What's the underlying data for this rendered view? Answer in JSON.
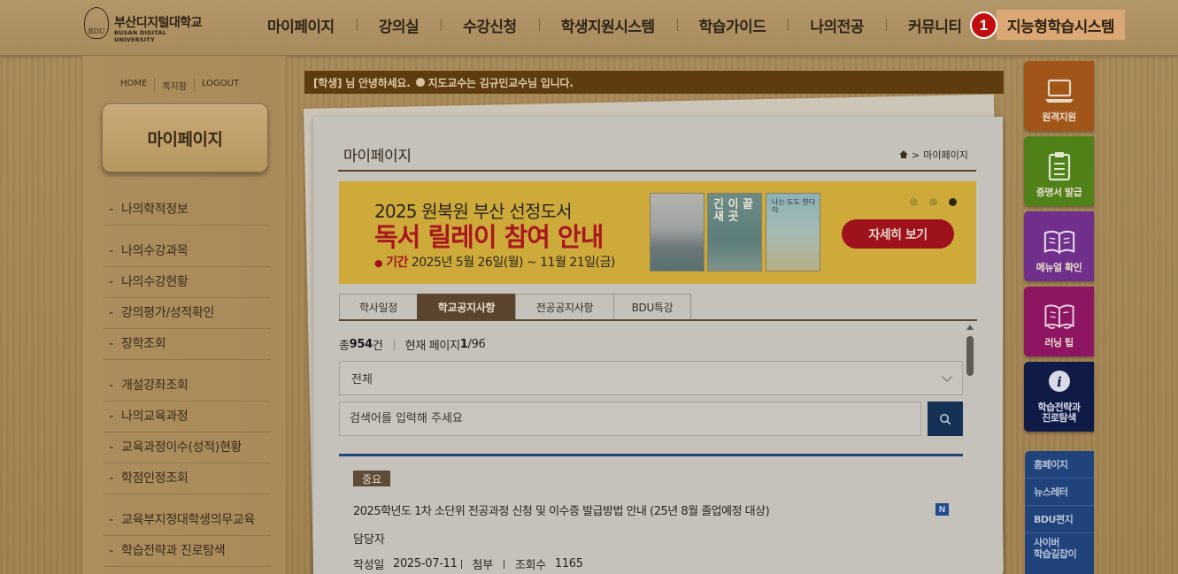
{
  "brand": {
    "name": "부산디지털대학교",
    "sub": "BUSAN DIGITAL UNIVERSITY",
    "mark": "BDU"
  },
  "topnav": {
    "items": [
      "마이페이지",
      "강의실",
      "수강신청",
      "학생지원시스템",
      "학습가이드",
      "나의전공",
      "커뮤니티"
    ],
    "special": "지능형학습시스템",
    "badge": "1"
  },
  "utils": [
    "HOME",
    "쪽지함",
    "LOGOUT"
  ],
  "sidebar": {
    "title": "마이페이지",
    "items": [
      "나의학적정보",
      "나의수강과목",
      "나의수강현황",
      "강의평가/성적확인",
      "장학조회",
      "개설강좌조회",
      "나의교육과정",
      "교육과정이수(성적)현황",
      "학점인정조회",
      "교육부지정대학생의무교육",
      "학습전략과 진로탐색"
    ]
  },
  "greeting": {
    "text1": "[학생] 님 안녕하세요.",
    "text2": "지도교수는 김규민교수님 입니다."
  },
  "page": {
    "title": "마이페이지",
    "breadcrumb_sep": ">",
    "breadcrumb": "마이페이지"
  },
  "banner": {
    "line1": "2025 원북원 부산 선정도서",
    "line2": "독서 릴레이 참여 안내",
    "period_label": "기간",
    "period": "2025년 5월 26일(월) ~ 11월 21일(금)",
    "book2_title": "긴 이 끝 새 곳",
    "book3_title": "나는 도도 한다이",
    "button": "자세히 보기",
    "active_slide": 3
  },
  "tabs": [
    "학사일정",
    "학교공지사항",
    "전공공지사항",
    "BDU특강"
  ],
  "active_tab": 1,
  "listing": {
    "total_prefix": "총 ",
    "total": "954",
    "total_suffix": "건",
    "page_prefix": "현재 페이지 ",
    "page_current": "1",
    "page_total": "/96",
    "filter": "전체",
    "search_placeholder": "검색어를 입력해 주세요"
  },
  "notice": {
    "badge": "중요",
    "title": "2025학년도 1차 소단위 전공과정 신청 및 이수증 발급방법 안내 (25년 8월 졸업예정 대상)",
    "new_badge": "N",
    "author": "담당자",
    "date_label": "작성일",
    "date": "2025-07-11",
    "attach_label": "첨부",
    "views_label": "조회수",
    "views": "1165"
  },
  "quickmenu": {
    "items": [
      {
        "label": "원격지원",
        "icon": "laptop-icon",
        "color": "#a25518"
      },
      {
        "label": "증명서 발급",
        "icon": "document-icon",
        "color": "#4f8118"
      },
      {
        "label": "메뉴얼 확인",
        "icon": "book-icon",
        "color": "#6f2f8a"
      },
      {
        "label": "러닝 팁",
        "icon": "reading-book-icon",
        "color": "#8d1561"
      },
      {
        "label": "학습전략과 진로탐색",
        "icon": "info-icon",
        "color": "#101a47"
      }
    ],
    "q5_line1": "학습전략과",
    "q5_line2": "진로탐색",
    "links": [
      "홈페이지",
      "뉴스레터",
      "BDU편지"
    ],
    "link4_line1": "사이버",
    "link4_line2": "학습길잡이"
  }
}
